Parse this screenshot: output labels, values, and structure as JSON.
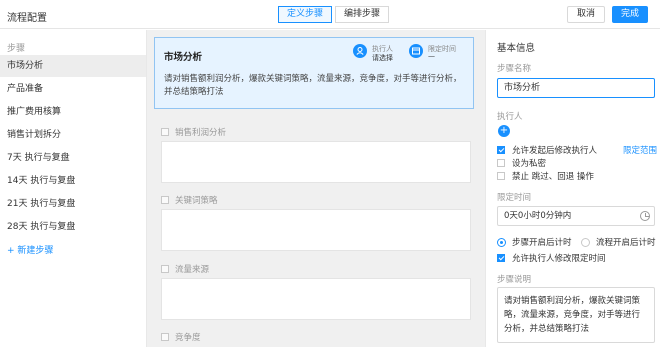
{
  "header": {
    "title": "流程配置",
    "tabs": [
      "定义步骤",
      "编排步骤"
    ],
    "cancel_label": "取消",
    "done_label": "完成"
  },
  "sidebar": {
    "heading": "步骤",
    "items": [
      "市场分析",
      "产品准备",
      "推广费用核算",
      "销售计划拆分",
      "7天 执行与复盘",
      "14天 执行与复盘",
      "21天 执行与复盘",
      "28天 执行与复盘"
    ],
    "active_index": 0,
    "add_label": "+ 新建步骤"
  },
  "canvas": {
    "card": {
      "title": "市场分析",
      "executor_label": "执行人",
      "executor_value": "请选择",
      "time_label": "限定时间",
      "time_value": "—",
      "description": "请对销售额利润分析，爆款关键词策略，流量来源，竞争度，对手等进行分析，并总结策略打法"
    },
    "fields": [
      "销售利润分析",
      "关键词策略",
      "流量来源",
      "竞争度"
    ]
  },
  "panel": {
    "title": "基本信息",
    "step_name_label": "步骤名称",
    "step_name_value": "市场分析",
    "executor_label": "执行人",
    "options": {
      "allow_change": "允许发起后修改执行人",
      "limit_range": "限定范围",
      "set_private": "设为私密",
      "forbid_ops": "禁止 跳过、回退 操作"
    },
    "time_label": "限定时间",
    "time_value": "0天0小时0分钟内",
    "radio_step": "步骤开启后计时",
    "radio_flow": "流程开启后计时",
    "allow_modify_time": "允许执行人修改限定时间",
    "desc_label": "步骤说明",
    "desc_value": "请对销售额利润分析，爆款关键词策略，流量来源，竞争度，对手等进行分析，并总结策略打法"
  },
  "colors": {
    "accent": "#1890ff",
    "card_bg": "#e6f3ff",
    "canvas_bg": "#f0f0f0"
  }
}
